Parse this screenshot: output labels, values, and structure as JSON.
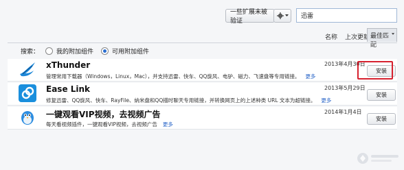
{
  "toolbar": {
    "verify_label": "一些扩展未被验证",
    "gear_icon": "gear-icon",
    "search_value": "迅雷"
  },
  "sort": {
    "name_label": "名称",
    "updated_label": "上次更新",
    "best_label": "最佳匹配"
  },
  "filter": {
    "prefix": "搜索：",
    "option_mine": "我的附加组件",
    "option_available": "可用附加组件",
    "selected": "option_available"
  },
  "addons": [
    {
      "name": "xThunder",
      "icon": "bird-icon",
      "description": "管理常用下载器（Windows，Linux，Mac），并支持迅雷、快车、QQ旋风、电驴、磁力、飞速盘等专用链接。",
      "more": "更多",
      "date": "2013年4月30日",
      "install": "安装"
    },
    {
      "name": "Ease Link",
      "icon": "link-icon",
      "description": "修复迅雷、QQ旋风、快车、RayFile、纳米盘和QQ描时聊天专用链接，并转换网页上的上述种类 URL 文本为超链接。",
      "more": "更多",
      "date": "2013年5月29日",
      "install": "安装"
    },
    {
      "name": "一键观看VIP视频，去视频广告",
      "icon": "bird-mascot-icon",
      "description": "每天看视频插件，一键观看VIP视频，去视频广告",
      "more": "更多",
      "date": "2014年1月4日",
      "install": "安装"
    }
  ],
  "colors": {
    "accent": "#2c6fd1",
    "highlight": "#d6202e",
    "link": "#2a66c8"
  }
}
